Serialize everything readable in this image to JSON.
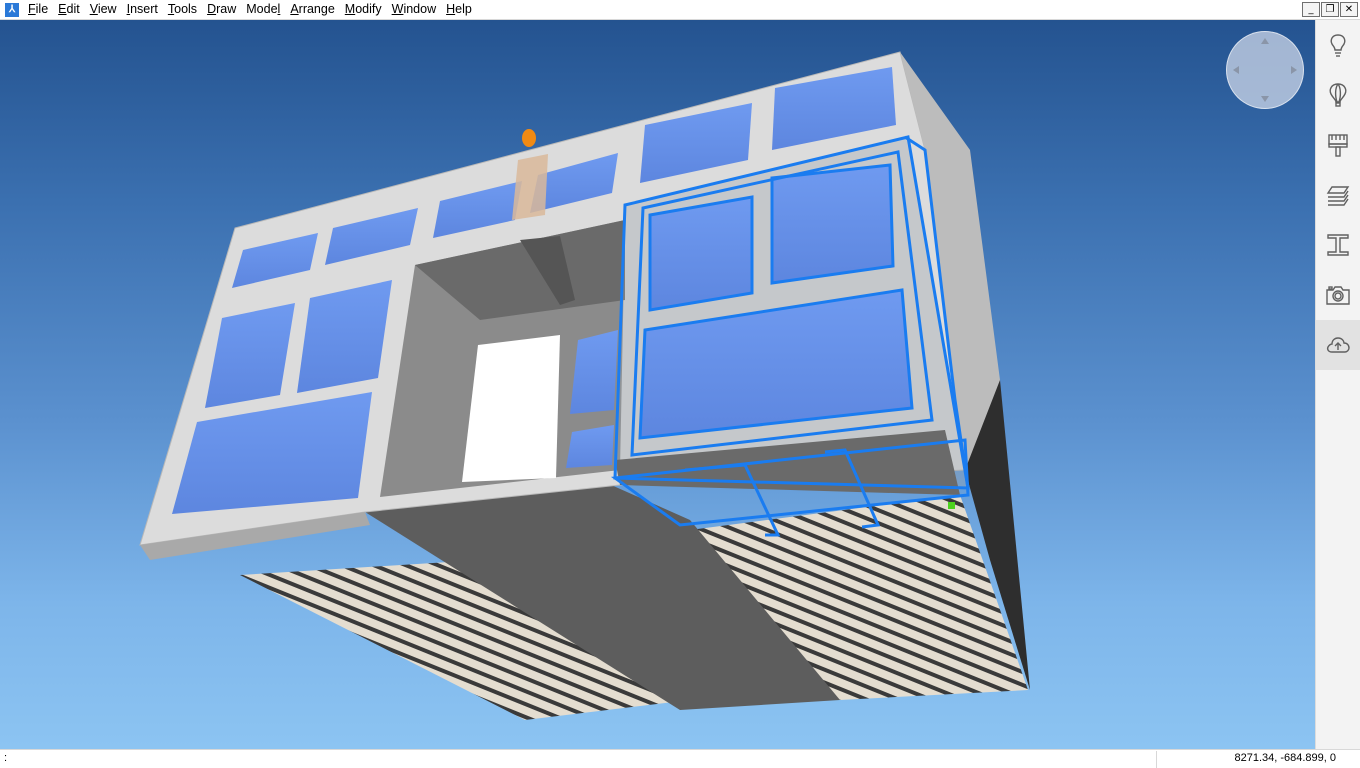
{
  "menu": [
    {
      "pre": "",
      "u": "F",
      "post": "ile"
    },
    {
      "pre": "",
      "u": "E",
      "post": "dit"
    },
    {
      "pre": "",
      "u": "V",
      "post": "iew"
    },
    {
      "pre": "",
      "u": "I",
      "post": "nsert"
    },
    {
      "pre": "",
      "u": "T",
      "post": "ools"
    },
    {
      "pre": "",
      "u": "D",
      "post": "raw"
    },
    {
      "pre": "Mode",
      "u": "l",
      "post": ""
    },
    {
      "pre": "",
      "u": "A",
      "post": "rrange"
    },
    {
      "pre": "",
      "u": "M",
      "post": "odify"
    },
    {
      "pre": "",
      "u": "W",
      "post": "indow"
    },
    {
      "pre": "",
      "u": "H",
      "post": "elp"
    }
  ],
  "window_controls": {
    "minimize": "_",
    "restore": "❐",
    "close": "✕"
  },
  "app_icon_glyph": "⅄",
  "toolbar_icons": [
    "lightbulb-icon",
    "balloon-icon",
    "paint-brush-icon",
    "layers-icon",
    "i-beam-icon",
    "camera-icon",
    "cloud-upload-icon"
  ],
  "status": {
    "prompt": ":",
    "coordinates": "8271.34, -684.899, 0"
  },
  "colors": {
    "selection": "#1a7cf0",
    "sky_top": "#245390",
    "sky_bottom": "#8cc4f2"
  }
}
